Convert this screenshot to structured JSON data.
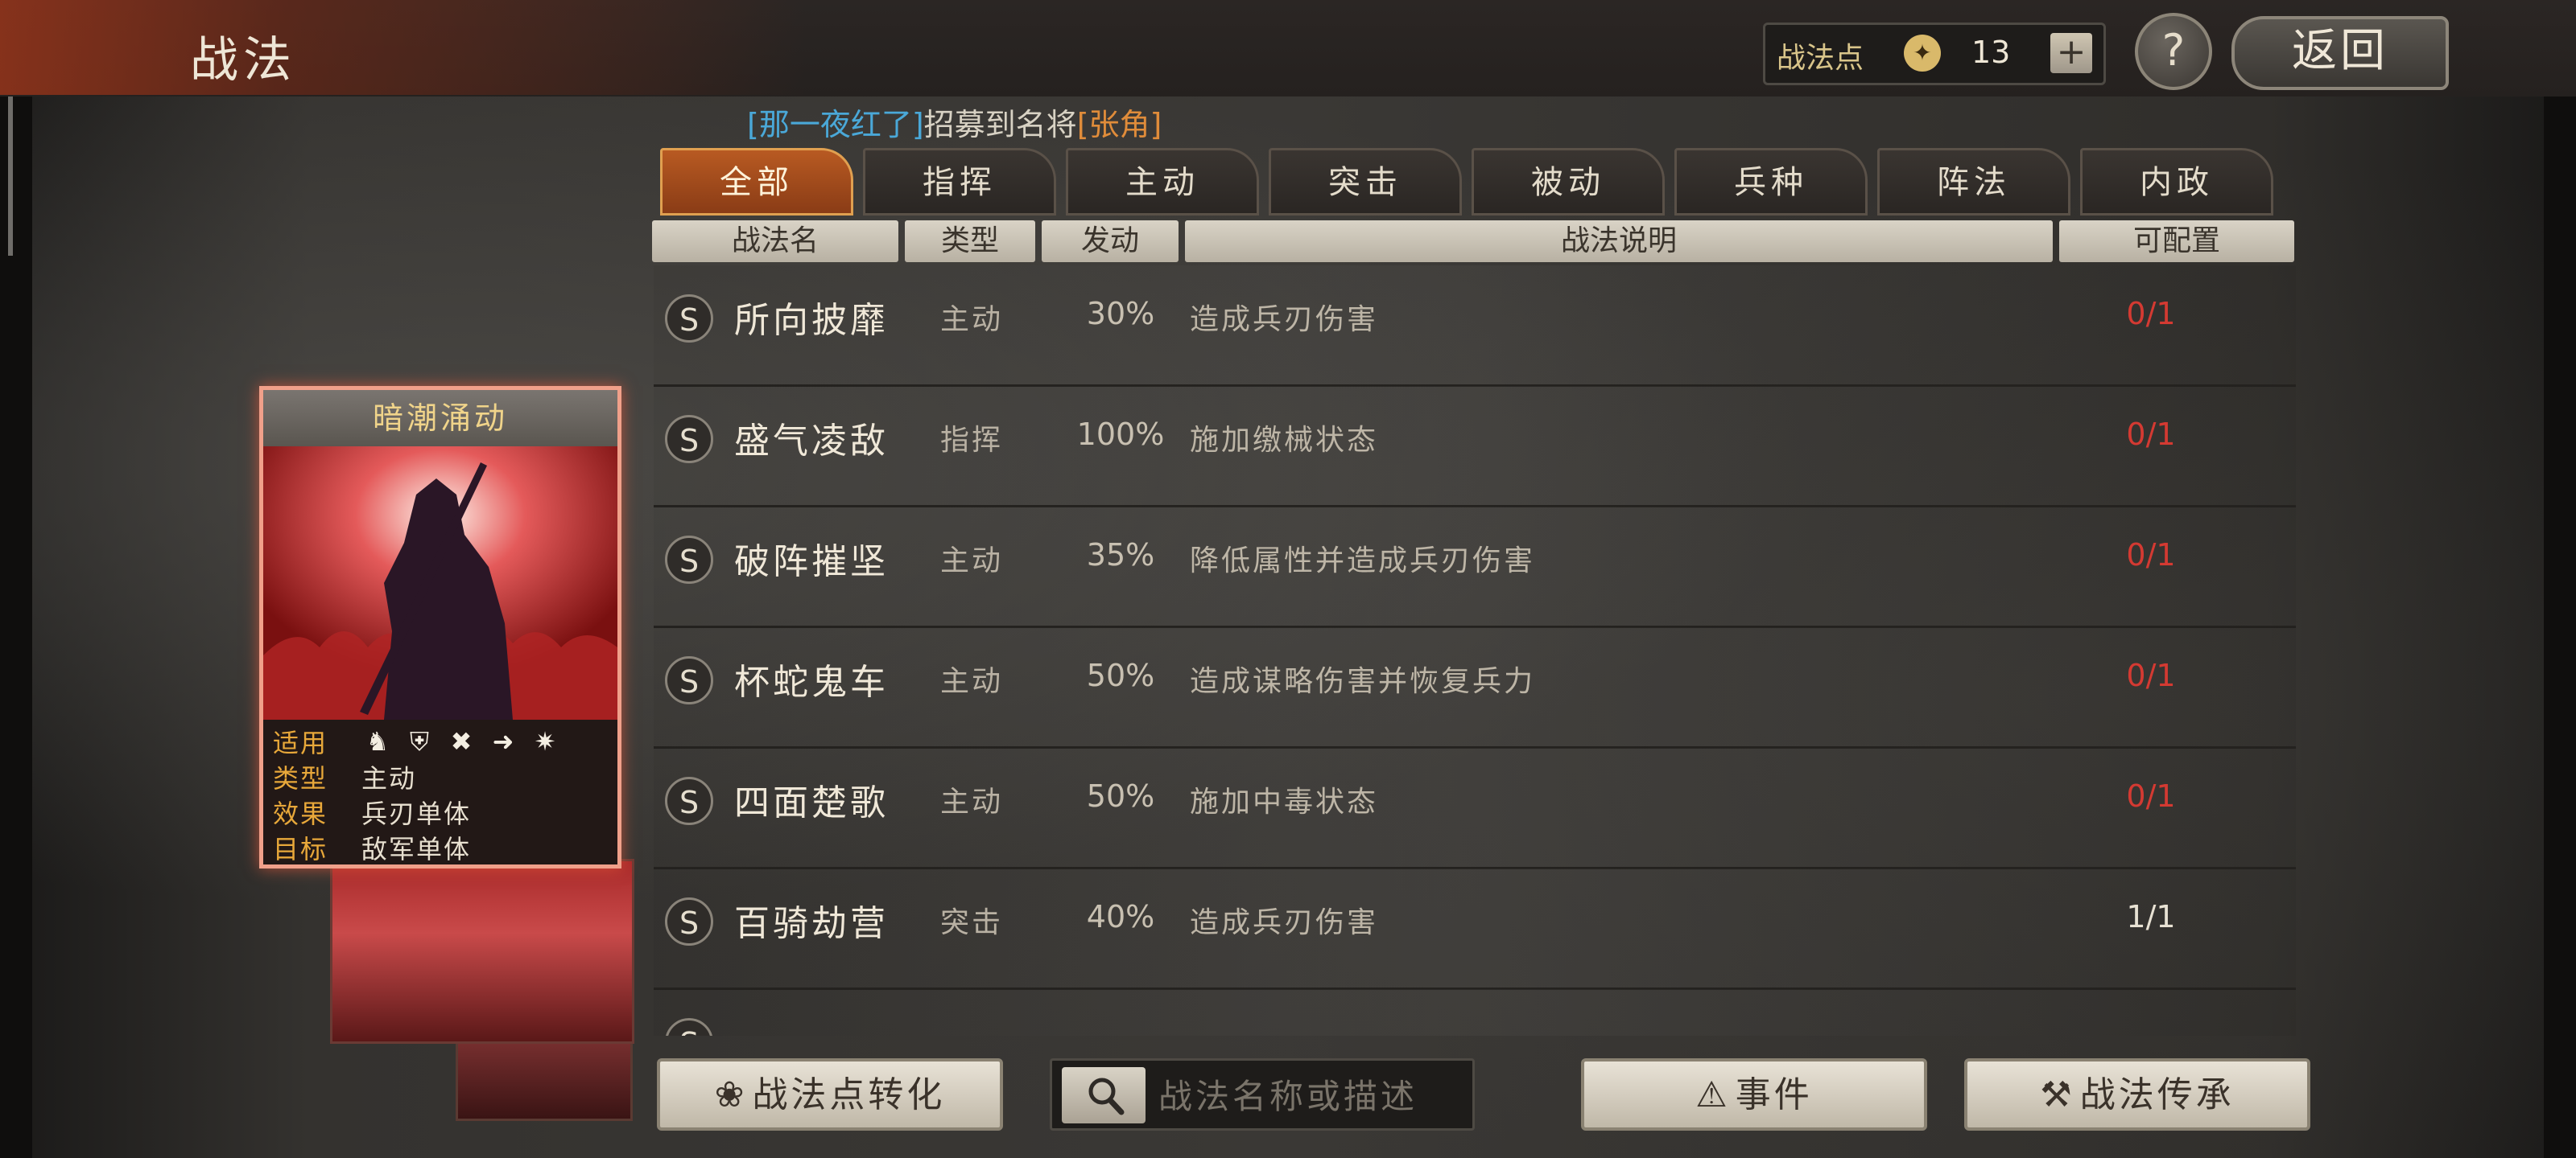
{
  "header": {
    "title": "战法",
    "points_label": "战法点",
    "points_value": "13",
    "plus_label": "+",
    "help_label": "?",
    "back_label": "返回"
  },
  "notice": {
    "open_bracket": "[",
    "player": "那一夜红了",
    "close_bracket": "]",
    "text": "招募到名将",
    "general_open": "[",
    "general": "张角",
    "general_close": "]"
  },
  "tabs": [
    "全部",
    "指挥",
    "主动",
    "突击",
    "被动",
    "兵种",
    "阵法",
    "内政"
  ],
  "active_tab": "全部",
  "columns": [
    "战法名",
    "类型",
    "发动",
    "战法说明",
    "可配置"
  ],
  "skills": [
    {
      "grade": "S",
      "name": "所向披靡",
      "type": "主动",
      "rate": "30%",
      "desc": "造成兵刃伤害",
      "avail": "0/1",
      "avail_color": "#d43a32"
    },
    {
      "grade": "S",
      "name": "盛气凌敌",
      "type": "指挥",
      "rate": "100%",
      "desc": "施加缴械状态",
      "avail": "0/1",
      "avail_color": "#d43a32"
    },
    {
      "grade": "S",
      "name": "破阵摧坚",
      "type": "主动",
      "rate": "35%",
      "desc": "降低属性并造成兵刃伤害",
      "avail": "0/1",
      "avail_color": "#d43a32"
    },
    {
      "grade": "S",
      "name": "杯蛇鬼车",
      "type": "主动",
      "rate": "50%",
      "desc": "造成谋略伤害并恢复兵力",
      "avail": "0/1",
      "avail_color": "#d43a32"
    },
    {
      "grade": "S",
      "name": "四面楚歌",
      "type": "主动",
      "rate": "50%",
      "desc": "施加中毒状态",
      "avail": "0/1",
      "avail_color": "#d43a32"
    },
    {
      "grade": "S",
      "name": "百骑劫营",
      "type": "突击",
      "rate": "40%",
      "desc": "造成兵刃伤害",
      "avail": "1/1",
      "avail_color": "#e8e2d4"
    }
  ],
  "card": {
    "title": "暗潮涌动",
    "rows": [
      {
        "key": "适用",
        "val": ""
      },
      {
        "key": "类型",
        "val": "主动"
      },
      {
        "key": "效果",
        "val": "兵刃单体"
      },
      {
        "key": "目标",
        "val": "敌军单体"
      }
    ],
    "troop_icons": [
      "cavalry-icon",
      "shield-icon",
      "bow-icon",
      "spear-icon",
      "wheel-icon"
    ]
  },
  "bottom": {
    "convert_label": "战法点转化",
    "search_placeholder": "战法名称或描述",
    "events_label": "事件",
    "inherit_label": "战法传承"
  },
  "colors": {
    "accent": "#b85a22",
    "unavailable": "#d43a32",
    "player_name": "#4aa8d8",
    "general_name": "#e08c3a"
  }
}
